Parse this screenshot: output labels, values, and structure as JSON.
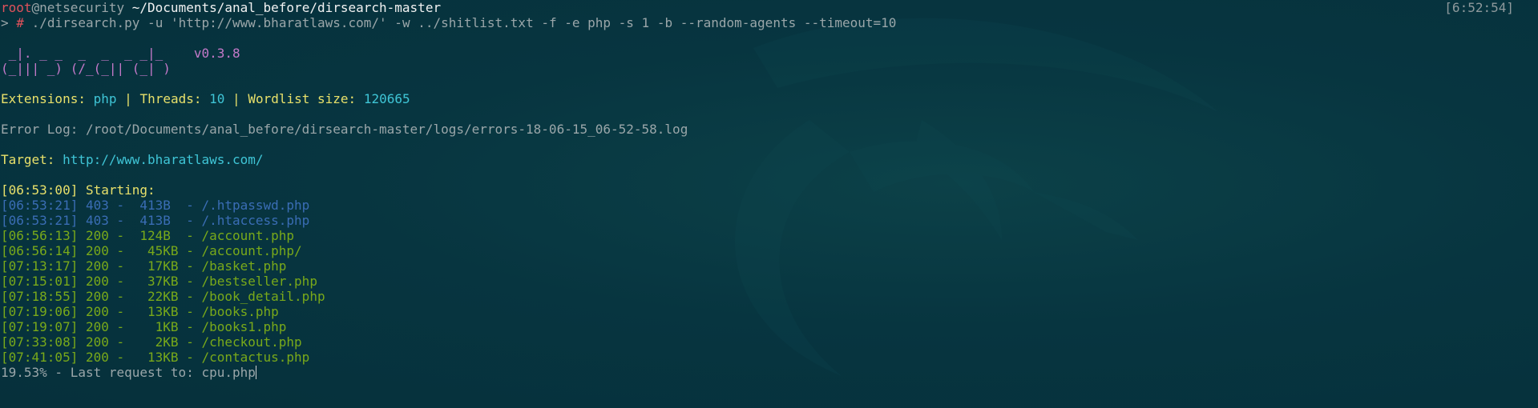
{
  "prompt": {
    "user": "root",
    "host": "@netsecurity",
    "path": "~/Documents/anal_before/dirsearch-master",
    "clock": "[6:52:54]",
    "symbol": ">",
    "hash": "#",
    "command": "./dirsearch.py -u 'http://www.bharatlaws.com/' -w ../shitlist.txt -f -e php -s 1 -b --random-agents --timeout=10"
  },
  "banner": {
    "line1": " _|. _ _  _  _  _ _|_",
    "version": "v0.3.8",
    "line2": "(_||| _) (/_(_|| (_| )"
  },
  "config": {
    "ext_label": "Extensions:",
    "ext_value": "php",
    "sep": "|",
    "threads_label": "Threads:",
    "threads_value": "10",
    "wordlist_label": "Wordlist size:",
    "wordlist_value": "120665"
  },
  "error_log": "Error Log: /root/Documents/anal_before/dirsearch-master/logs/errors-18-06-15_06-52-58.log",
  "target": {
    "label": "Target:",
    "url": "http://www.bharatlaws.com/"
  },
  "starting": "[06:53:00] Starting:",
  "results": [
    {
      "text": "[06:53:21] 403 -  413B  - /.htpasswd.php",
      "status": "403"
    },
    {
      "text": "[06:53:21] 403 -  413B  - /.htaccess.php",
      "status": "403"
    },
    {
      "text": "[06:56:13] 200 -  124B  - /account.php",
      "status": "200"
    },
    {
      "text": "[06:56:14] 200 -   45KB - /account.php/",
      "status": "200"
    },
    {
      "text": "[07:13:17] 200 -   17KB - /basket.php",
      "status": "200"
    },
    {
      "text": "[07:15:01] 200 -   37KB - /bestseller.php",
      "status": "200"
    },
    {
      "text": "[07:18:55] 200 -   22KB - /book_detail.php",
      "status": "200"
    },
    {
      "text": "[07:19:06] 200 -   13KB - /books.php",
      "status": "200"
    },
    {
      "text": "[07:19:07] 200 -    1KB - /books1.php",
      "status": "200"
    },
    {
      "text": "[07:33:08] 200 -    2KB - /checkout.php",
      "status": "200"
    },
    {
      "text": "[07:41:05] 200 -   13KB - /contactus.php",
      "status": "200"
    }
  ],
  "progress": "19.53% - Last request to: cpu.php",
  "colors": {
    "background": "#073540",
    "user": "#e0525b",
    "status_403": "#3a6db5",
    "status_200": "#79a91a",
    "highlight": "#e8e06a",
    "value": "#3fc5d6"
  }
}
